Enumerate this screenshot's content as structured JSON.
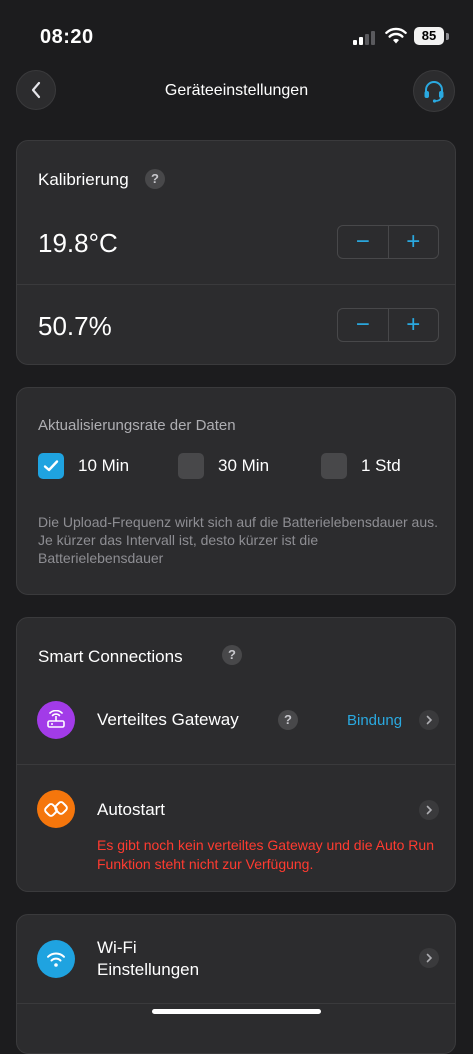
{
  "status_bar": {
    "time": "08:20",
    "battery": "85"
  },
  "nav": {
    "title": "Geräteeinstellungen",
    "back_icon": "chevron-left-icon",
    "support_icon": "headset-icon"
  },
  "calibration": {
    "title": "Kalibrierung",
    "help": "?",
    "rows": [
      {
        "value": "19.8°C",
        "minus": "−",
        "plus": "+"
      },
      {
        "value": "50.7%",
        "minus": "−",
        "plus": "+"
      }
    ]
  },
  "update_rate": {
    "title": "Aktualisierungsrate der Daten",
    "options": [
      {
        "label": "10 Min",
        "checked": true
      },
      {
        "label": "30 Min",
        "checked": false
      },
      {
        "label": "1 Std",
        "checked": false
      }
    ],
    "note": "Die Upload-Frequenz wirkt sich auf die Batterielebensdauer aus. Je kürzer das Intervall ist, desto kürzer ist die Batterielebensdauer"
  },
  "smart_connections": {
    "title": "Smart Connections",
    "help": "?",
    "gateway": {
      "label": "Verteiltes Gateway",
      "help": "?",
      "action": "Bindung"
    },
    "autostart": {
      "label": "Autostart",
      "warning": "Es gibt noch kein verteiltes Gateway und die Auto Run Funktion steht nicht zur Verfügung."
    }
  },
  "wifi_settings": {
    "label_line1": "Wi-Fi",
    "label_line2": "Einstellungen"
  },
  "colors": {
    "accent": "#2aa9e0",
    "checkbox_checked": "#1fa3e0",
    "gateway_icon": "#a23be8",
    "autostart_icon": "#f5760c",
    "wifi_icon": "#1fa3e0",
    "warning": "#ff3b30"
  }
}
